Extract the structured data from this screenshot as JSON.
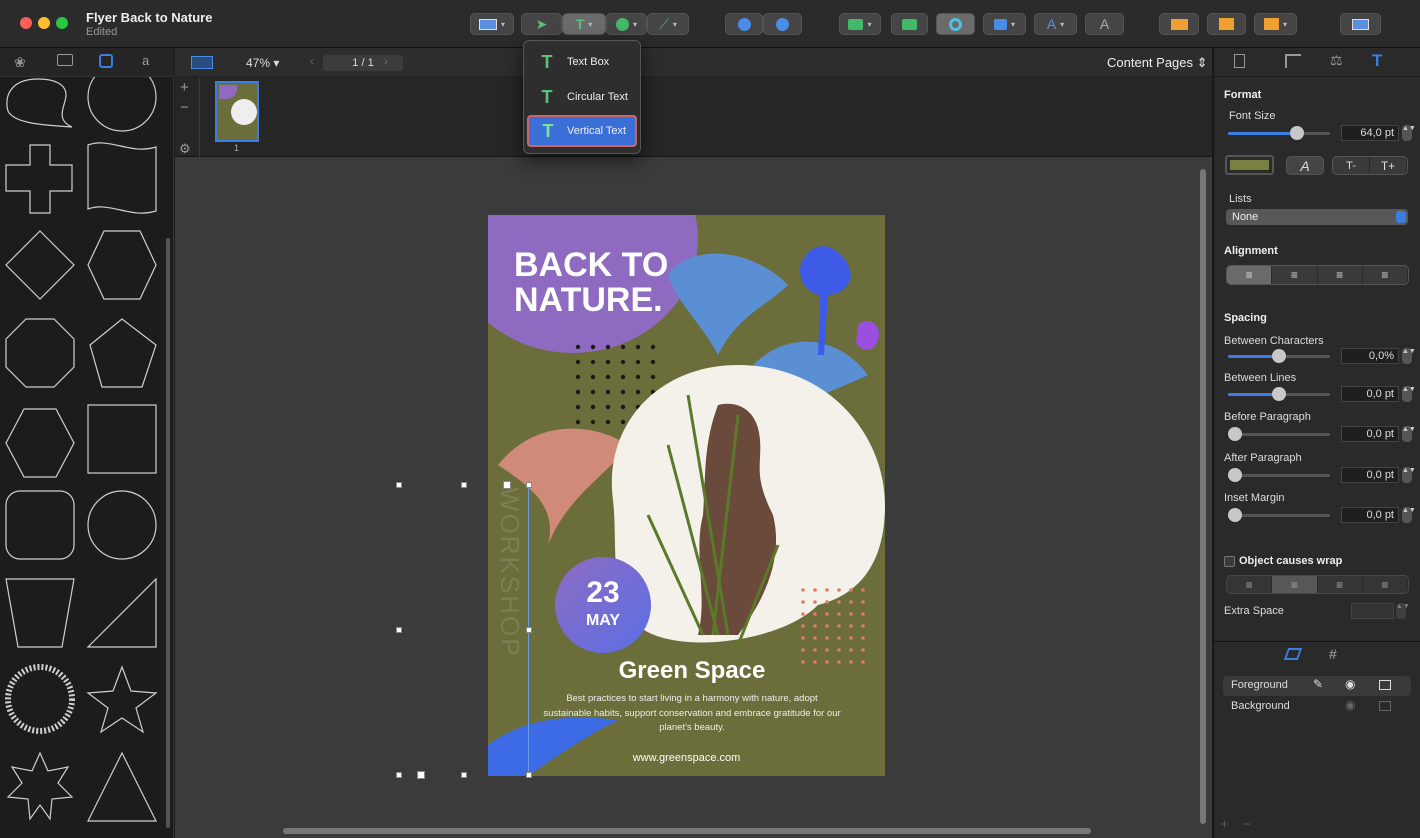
{
  "window": {
    "title": "Flyer Back to Nature",
    "subtitle": "Edited"
  },
  "nav": {
    "zoom": "47%",
    "page": "1 / 1",
    "view": "Content Pages"
  },
  "pagestrip": {
    "page_num": "1"
  },
  "dropdown": {
    "items": [
      {
        "label": "Text Box"
      },
      {
        "label": "Circular Text"
      },
      {
        "label": "Vertical Text"
      }
    ]
  },
  "flyer": {
    "headline1": "BACK TO",
    "headline2": "NATURE.",
    "vertical": "WORKSHOP",
    "day": "23",
    "month": "MAY",
    "title": "Green Space",
    "body1": "Best practices to start living in a harmony with nature, adopt",
    "body2": "sustainable habits, support conservation and embrace gratitude for our",
    "body3": "planet's beauty.",
    "url": "www.greenspace.com"
  },
  "inspector": {
    "format": "Format",
    "font_size_label": "Font Size",
    "font_size": "64,0 pt",
    "lists_label": "Lists",
    "lists_value": "None",
    "alignment": "Alignment",
    "spacing": "Spacing",
    "between_chars": "Between Characters",
    "between_chars_val": "0,0%",
    "between_lines": "Between Lines",
    "between_lines_val": "0,0 pt",
    "before_para": "Before Paragraph",
    "before_para_val": "0,0 pt",
    "after_para": "After Paragraph",
    "after_para_val": "0,0 pt",
    "inset": "Inset Margin",
    "inset_val": "0,0 pt",
    "wrap": "Object causes wrap",
    "extra": "Extra Space",
    "swatch_color": "#7a8040"
  },
  "layers": [
    {
      "name": "Foreground"
    },
    {
      "name": "Background"
    }
  ],
  "colors": {
    "accent": "#3b7de0",
    "purple": "#8e6bc1",
    "olive": "#6b6d3b"
  }
}
